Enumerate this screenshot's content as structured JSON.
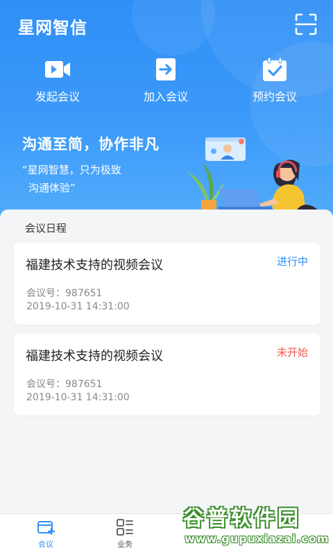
{
  "header": {
    "app_title": "星网智信",
    "scan_icon": "scan-icon",
    "accent": "#2f8ff7"
  },
  "actions": [
    {
      "label": "发起会议",
      "icon": "video-camera-icon"
    },
    {
      "label": "加入会议",
      "icon": "enter-icon"
    },
    {
      "label": "预约会议",
      "icon": "calendar-check-icon"
    }
  ],
  "banner": {
    "slogan": "沟通至简，协作非凡",
    "quote_line1": "“星网智慧，只为极致",
    "quote_line2": "沟通体验”"
  },
  "schedule": {
    "title": "会议日程",
    "meetings": [
      {
        "name": "福建技术支持的视频会议",
        "status": "进行中",
        "status_color": "#2f8ff7",
        "number": "会议号：987651",
        "time": "2019-10-31  14:31:00"
      },
      {
        "name": "福建技术支持的视频会议",
        "status": "未开始",
        "status_color": "#f2584a",
        "number": "会议号：987651",
        "time": "2019-10-31  14:31:00"
      }
    ]
  },
  "tabbar": {
    "tabs": [
      {
        "label": "会议",
        "icon": "meeting-icon",
        "active": true
      },
      {
        "label": "业务",
        "icon": "grid-list-icon",
        "active": false
      }
    ]
  },
  "watermark": {
    "line1": "谷普软件园",
    "line2": "www.gupuxiazai.com"
  }
}
